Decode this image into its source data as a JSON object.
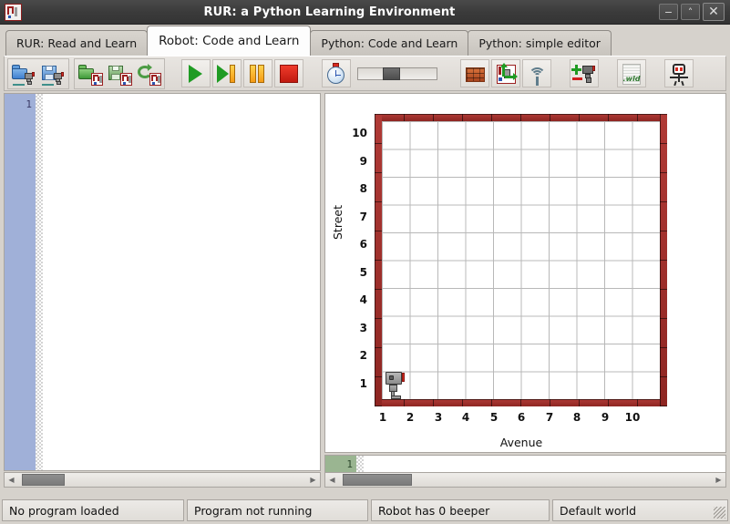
{
  "window": {
    "title": "RUR: a Python Learning Environment",
    "icon": "world-map-icon",
    "buttons": {
      "minimize": "−",
      "maximize": "˄",
      "close": "✕"
    }
  },
  "tabs": [
    {
      "label": "RUR: Read and Learn",
      "active": false
    },
    {
      "label": "Robot: Code and Learn",
      "active": true
    },
    {
      "label": "Python: Code and Learn",
      "active": false
    },
    {
      "label": "Python: simple editor",
      "active": false
    }
  ],
  "toolbar": {
    "groups": [
      {
        "name": "file-program",
        "buttons": [
          {
            "name": "open-program-button",
            "icon": "open-folder-robot-icon",
            "tooltip": "Open program"
          },
          {
            "name": "save-program-button",
            "icon": "save-floppy-robot-icon",
            "tooltip": "Save program"
          }
        ]
      },
      {
        "name": "file-world",
        "buttons": [
          {
            "name": "open-world-button",
            "icon": "open-folder-world-icon",
            "tooltip": "Open world"
          },
          {
            "name": "save-world-button",
            "icon": "save-floppy-world-icon",
            "tooltip": "Save world"
          },
          {
            "name": "reload-world-button",
            "icon": "recycle-world-icon",
            "tooltip": "Reload world"
          }
        ]
      },
      {
        "name": "run-controls",
        "buttons": [
          {
            "name": "run-button",
            "icon": "play-icon",
            "tooltip": "Run"
          },
          {
            "name": "step-button",
            "icon": "play-step-icon",
            "tooltip": "Step"
          },
          {
            "name": "pause-button",
            "icon": "pause-icon",
            "tooltip": "Pause"
          },
          {
            "name": "stop-button",
            "icon": "stop-icon",
            "tooltip": "Stop"
          }
        ]
      },
      {
        "name": "speed-controls",
        "buttons": [
          {
            "name": "timer-button",
            "icon": "clock-icon",
            "tooltip": "Execution speed"
          }
        ],
        "slider": {
          "name": "speed-slider",
          "value": 33,
          "min": 0,
          "max": 100
        }
      },
      {
        "name": "world-edit",
        "buttons": [
          {
            "name": "add-wall-button",
            "icon": "brick-wall-icon",
            "tooltip": "Add wall"
          },
          {
            "name": "edit-world-button",
            "icon": "world-editor-icon",
            "tooltip": "Edit world size"
          },
          {
            "name": "beeper-button",
            "icon": "wifi-beeper-icon",
            "tooltip": "Beepers"
          }
        ]
      },
      {
        "name": "robot-edit",
        "buttons": [
          {
            "name": "add-remove-robot-button",
            "icon": "plus-minus-robot-icon",
            "tooltip": "Add or remove robot"
          }
        ]
      },
      {
        "name": "wld-file",
        "buttons": [
          {
            "name": "wld-file-button",
            "icon": "wld-file-icon",
            "label": ".wld",
            "tooltip": "World file"
          }
        ]
      },
      {
        "name": "about",
        "buttons": [
          {
            "name": "reeborg-button",
            "icon": "stick-robot-icon",
            "tooltip": "Reeborg"
          }
        ]
      }
    ]
  },
  "editor": {
    "line_numbers": [
      "1"
    ],
    "content": "",
    "hscrollbar": {
      "name": "editor-hscrollbar",
      "thumb_left": 4,
      "thumb_width": 47
    }
  },
  "world": {
    "axis": {
      "x_label": "Avenue",
      "y_label": "Street",
      "x_ticks": [
        "1",
        "2",
        "3",
        "4",
        "5",
        "6",
        "7",
        "8",
        "9",
        "10"
      ],
      "y_ticks": [
        "1",
        "2",
        "3",
        "4",
        "5",
        "6",
        "7",
        "8",
        "9",
        "10"
      ]
    },
    "colors": {
      "wall": "#a03030",
      "grid_line": "#b0b0b0",
      "background": "#ffffff"
    },
    "robot": {
      "name": "reeborg-robot",
      "avenue": 1,
      "street": 1,
      "orientation": "east"
    },
    "mini_editor": {
      "line_numbers": [
        "1"
      ],
      "content": ""
    },
    "hscrollbar": {
      "name": "world-hscrollbar",
      "thumb_left": 4,
      "thumb_width": 76
    }
  },
  "statusbar": {
    "cells": [
      {
        "name": "program-status",
        "text": "No program loaded"
      },
      {
        "name": "run-status",
        "text": "Program not running"
      },
      {
        "name": "beeper-status",
        "text": "Robot has 0 beeper"
      },
      {
        "name": "world-status",
        "text": "Default world"
      }
    ]
  }
}
